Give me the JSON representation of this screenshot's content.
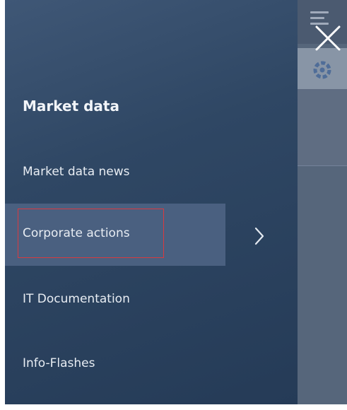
{
  "menu": {
    "heading": "Market data",
    "items": [
      {
        "label": "Market data news",
        "active": false
      },
      {
        "label": "Corporate actions",
        "active": true,
        "has_submenu": true
      },
      {
        "label": "IT Documentation",
        "active": false
      },
      {
        "label": "Info-Flashes",
        "active": false
      }
    ]
  },
  "icons": {
    "close": "close-icon",
    "submenu": "chevron-right-icon",
    "menu": "hamburger-icon",
    "gear": "gear-icon"
  },
  "colors": {
    "drawer_bg": "#2f4764",
    "active_item_bg": "#4a6080",
    "highlight_border": "#d83a40",
    "text": "#e8edf3"
  }
}
